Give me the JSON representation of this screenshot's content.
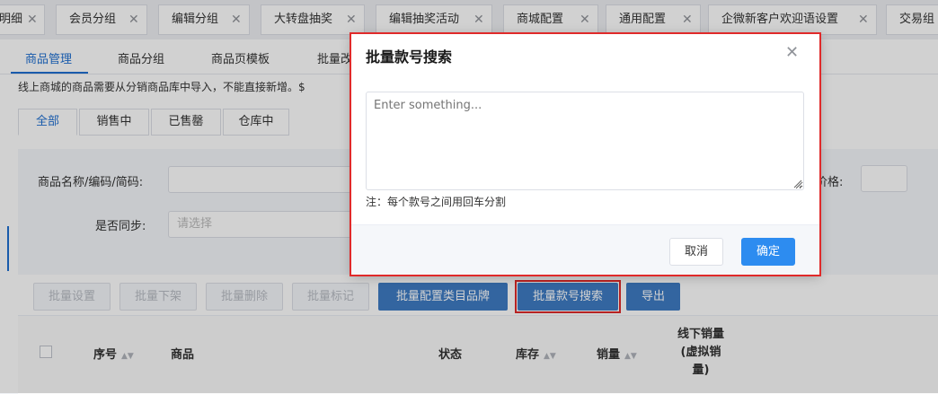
{
  "top_tabs": [
    {
      "label": "明细"
    },
    {
      "label": "会员分组"
    },
    {
      "label": "编辑分组"
    },
    {
      "label": "大转盘抽奖"
    },
    {
      "label": "编辑抽奖活动"
    },
    {
      "label": "商城配置"
    },
    {
      "label": "通用配置"
    },
    {
      "label": "企微新客户欢迎语设置"
    },
    {
      "label": "交易组"
    }
  ],
  "sub_tabs": [
    "商品管理",
    "商品分组",
    "商品页模板",
    "批量改"
  ],
  "notice": "线上商城的商品需要从分销商品库中导入，不能直接新增。$",
  "status_tabs": [
    "全部",
    "销售中",
    "已售罄",
    "仓库中"
  ],
  "filters": {
    "name_label": "商品名称/编码/简码:",
    "sync_label": "是否同步:",
    "sync_placeholder": "请选择",
    "price_label": "价格:"
  },
  "toolbar": {
    "batch_set": "批量设置",
    "batch_offshelf": "批量下架",
    "batch_delete": "批量删除",
    "batch_tag": "批量标记",
    "batch_category_brand": "批量配置类目品牌",
    "batch_style_search": "批量款号搜索",
    "export": "导出"
  },
  "table": {
    "col_index": "序号",
    "col_product": "商品",
    "col_status": "状态",
    "col_stock": "库存",
    "col_sales": "销量",
    "col_offline_1": "线下销量",
    "col_offline_2": "(虚拟销",
    "col_offline_3": "量)"
  },
  "modal": {
    "title": "批量款号搜索",
    "placeholder": "Enter something...",
    "value": "",
    "hint": "注：每个款号之间用回车分割",
    "cancel": "取消",
    "confirm": "确定"
  },
  "icons": {
    "close": "close-icon",
    "sort": "sort-icon",
    "resize": "resize-grip-icon"
  },
  "colors": {
    "primary": "#2d8cf0",
    "toolbar_primary": "#3f7cc4",
    "active_tab": "#1f6fd1",
    "highlight": "#e02a2a"
  }
}
